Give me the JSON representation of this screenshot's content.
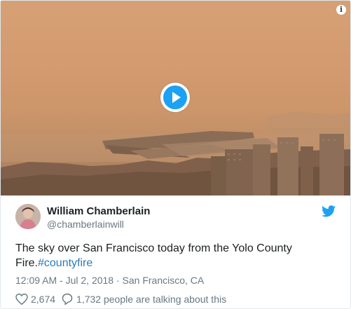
{
  "media": {
    "info_glyph": "i",
    "play_icon": "play-icon"
  },
  "author": {
    "name": "William Chamberlain",
    "handle": "@chamberlainwill"
  },
  "tweet": {
    "text": "The sky over San Francisco today from the Yolo County Fire.",
    "hashtag": "#countyfire"
  },
  "meta": {
    "time": "12:09 AM - Jul 2, 2018",
    "separator": "·",
    "location": "San Francisco, CA"
  },
  "actions": {
    "likes": "2,674",
    "replies_text": "1,732 people are talking about this"
  },
  "colors": {
    "accent": "#1da1f2",
    "link": "#2b7bb9",
    "muted": "#697882",
    "sky": "#d7a277"
  }
}
